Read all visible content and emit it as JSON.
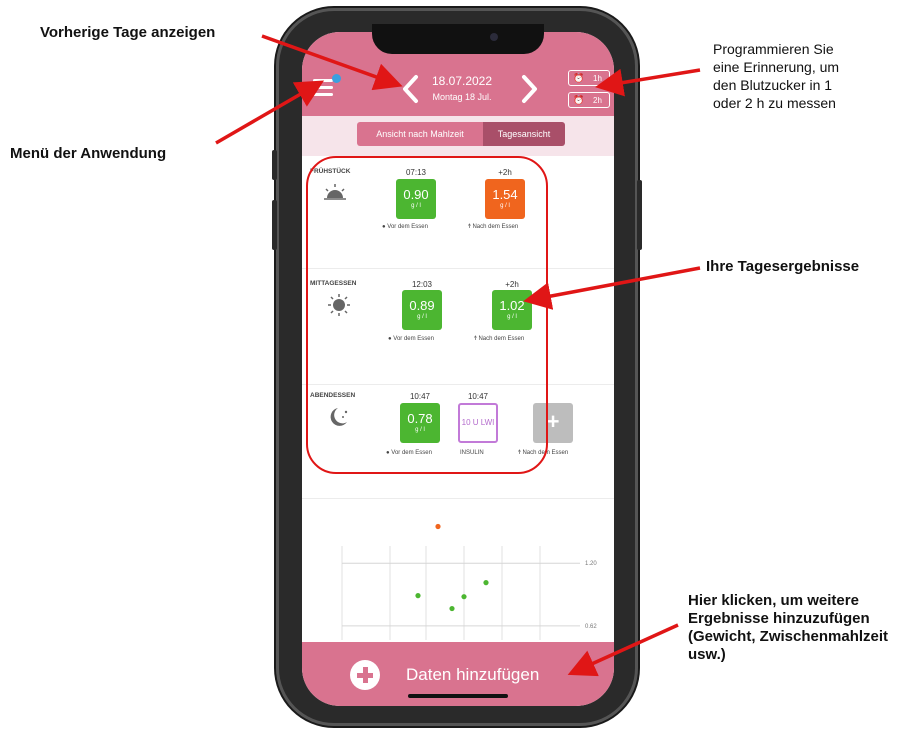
{
  "annotations": {
    "previous_days": "Vorherige Tage anzeigen",
    "app_menu": "Menü der Anwendung",
    "reminder_line1": "Programmieren Sie",
    "reminder_line2": "eine Erinnerung, um",
    "reminder_line3": "den Blutzucker in 1",
    "reminder_line4": "oder 2 h zu messen",
    "daily_results": "Ihre Tagesergebnisse",
    "add_more_line1": "Hier klicken, um weitere",
    "add_more_line2": "Ergebnisse hinzuzufügen",
    "add_more_line3": "(Gewicht, Zwischenmahlzeit",
    "add_more_line4": "usw.)"
  },
  "header": {
    "date": "18.07.2022",
    "day": "Montag 18 Jul.",
    "alarm_1h": "1h",
    "alarm_2h": "2h"
  },
  "view_toggle": {
    "by_meal": "Ansicht nach Mahlzeit",
    "daily": "Tagesansicht"
  },
  "meals": {
    "breakfast": {
      "title": "FRÜHSTÜCK",
      "before_time": "07:13",
      "before_value": "0.90",
      "before_unit": "g / l",
      "before_label": "Vor dem Essen",
      "after_time": "+2h",
      "after_value": "1.54",
      "after_unit": "g / l",
      "after_label": "Nach dem Essen"
    },
    "lunch": {
      "title": "MITTAGESSEN",
      "before_time": "12:03",
      "before_value": "0.89",
      "before_unit": "g / l",
      "before_label": "Vor dem Essen",
      "after_time": "+2h",
      "after_value": "1.02",
      "after_unit": "g / l",
      "after_label": "Nach dem Essen"
    },
    "dinner": {
      "title": "ABENDESSEN",
      "before_time": "10:47",
      "before_value": "0.78",
      "before_unit": "g / l",
      "before_label": "Vor dem Essen",
      "insulin_time": "10:47",
      "insulin_value": "10 U LWI",
      "insulin_label": "INSULIN",
      "after_label": "Nach dem Essen"
    }
  },
  "colors": {
    "brand_pink": "#d9738f",
    "in_range": "#4cb631",
    "high": "#f0651e",
    "insulin": "#c27ad8",
    "annotation_red": "#e01616"
  },
  "chart_data": {
    "type": "scatter",
    "y_ticks": [
      "1.20",
      "0.62"
    ],
    "points": [
      {
        "y": 1.54,
        "color": "#f0651e"
      },
      {
        "y": 0.9,
        "color": "#4cb631"
      },
      {
        "y": 0.78,
        "color": "#4cb631"
      },
      {
        "y": 0.89,
        "color": "#4cb631"
      },
      {
        "y": 1.02,
        "color": "#4cb631"
      }
    ]
  },
  "bottom_bar": {
    "label": "Daten hinzufügen"
  }
}
